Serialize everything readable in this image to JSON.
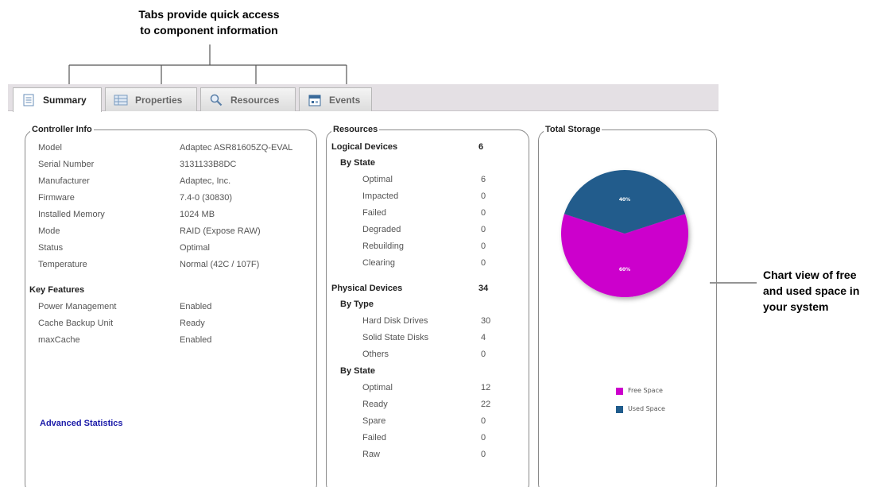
{
  "callouts": {
    "tabs_line1": "Tabs provide quick access",
    "tabs_line2": "to component information",
    "chart_line1": "Chart view of free",
    "chart_line2": "and used space in",
    "chart_line3": "your system"
  },
  "tabs": [
    {
      "label": "Summary",
      "icon": "document-icon",
      "active": true
    },
    {
      "label": "Properties",
      "icon": "properties-icon",
      "active": false
    },
    {
      "label": "Resources",
      "icon": "magnifier-icon",
      "active": false
    },
    {
      "label": "Events",
      "icon": "calendar-icon",
      "active": false
    }
  ],
  "controller_info": {
    "title": "Controller Info",
    "rows": [
      {
        "label": "Model",
        "value": "Adaptec ASR81605ZQ-EVAL"
      },
      {
        "label": "Serial Number",
        "value": "3131133B8DC"
      },
      {
        "label": "Manufacturer",
        "value": "Adaptec, Inc."
      },
      {
        "label": "Firmware",
        "value": "7.4-0 (30830)"
      },
      {
        "label": "Installed Memory",
        "value": "1024 MB"
      },
      {
        "label": "Mode",
        "value": "RAID (Expose RAW)"
      },
      {
        "label": "Status",
        "value": "Optimal"
      },
      {
        "label": "Temperature",
        "value": "Normal (42C / 107F)"
      }
    ],
    "key_features_title": "Key Features",
    "features": [
      {
        "label": "Power Management",
        "value": "Enabled"
      },
      {
        "label": "Cache Backup Unit",
        "value": "Ready"
      },
      {
        "label": "maxCache",
        "value": "Enabled"
      }
    ],
    "advanced_link": "Advanced Statistics"
  },
  "resources": {
    "title": "Resources",
    "logical_label": "Logical Devices",
    "logical_count": "6",
    "logical_by_state": "By State",
    "logical_states": [
      {
        "label": "Optimal",
        "value": "6"
      },
      {
        "label": "Impacted",
        "value": "0"
      },
      {
        "label": "Failed",
        "value": "0"
      },
      {
        "label": "Degraded",
        "value": "0"
      },
      {
        "label": "Rebuilding",
        "value": "0"
      },
      {
        "label": "Clearing",
        "value": "0"
      }
    ],
    "physical_label": "Physical Devices",
    "physical_count": "34",
    "physical_by_type": "By Type",
    "physical_types": [
      {
        "label": "Hard Disk Drives",
        "value": "30"
      },
      {
        "label": "Solid State Disks",
        "value": "4"
      },
      {
        "label": "Others",
        "value": "0"
      }
    ],
    "physical_by_state": "By State",
    "physical_states": [
      {
        "label": "Optimal",
        "value": "12"
      },
      {
        "label": "Ready",
        "value": "22"
      },
      {
        "label": "Spare",
        "value": "0"
      },
      {
        "label": "Failed",
        "value": "0"
      },
      {
        "label": "Raw",
        "value": "0"
      }
    ]
  },
  "total_storage": {
    "title": "Total Storage",
    "legend_free": "Free Space",
    "legend_used": "Used Space",
    "free_label": "60%",
    "used_label": "40%",
    "free_color": "#cc00cc",
    "used_color": "#205c8c"
  },
  "chart_data": {
    "type": "pie",
    "categories": [
      "Free Space",
      "Used Space"
    ],
    "values": [
      60,
      40
    ],
    "title": "Total Storage",
    "colors": [
      "#cc00cc",
      "#205c8c"
    ],
    "legend": "bottom-right"
  }
}
